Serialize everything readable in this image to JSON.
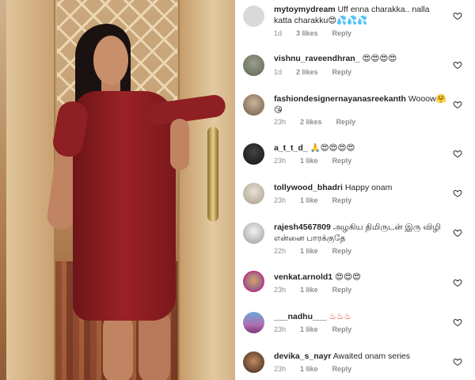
{
  "colors": {
    "meta": "#8e8e8e",
    "text": "#262626",
    "dress": "#9a2226"
  },
  "photo": {
    "subject": "woman-in-red-dress"
  },
  "comments": [
    {
      "username": "mytoymydream",
      "text": "Uff enna charakka.. nalla katta charakku😍💦💦💦",
      "time": "1d",
      "likes": "3 likes",
      "reply": "Reply"
    },
    {
      "username": "vishnu_raveendhran_",
      "text": "😍😍😍😍",
      "time": "1d",
      "likes": "2 likes",
      "reply": "Reply"
    },
    {
      "username": "fashiondesignernayanasreekanth",
      "text": "Wooow🤗😘",
      "time": "23h",
      "likes": "2 likes",
      "reply": "Reply"
    },
    {
      "username": "a_t_t_d_",
      "text": "🙏😍😍😍😍",
      "time": "23h",
      "likes": "1 like",
      "reply": "Reply"
    },
    {
      "username": "tollywood_bhadri",
      "text": "Happy onam",
      "time": "23h",
      "likes": "1 like",
      "reply": "Reply"
    },
    {
      "username": "rajesh4567809",
      "text": "அழகிய திமிருடன் இரு விழி என்னை பாரக்குதே",
      "time": "22h",
      "likes": "1 like",
      "reply": "Reply"
    },
    {
      "username": "venkat.arnold1",
      "text": "😍😍😍",
      "time": "23h",
      "likes": "1 like",
      "reply": "Reply"
    },
    {
      "username": "___nadhu___",
      "text": "♨♨♨",
      "time": "23h",
      "likes": "1 like",
      "reply": "Reply"
    },
    {
      "username": "devika_s_nayr",
      "text": "Awaited onam series",
      "time": "23h",
      "likes": "1 like",
      "reply": "Reply"
    }
  ]
}
